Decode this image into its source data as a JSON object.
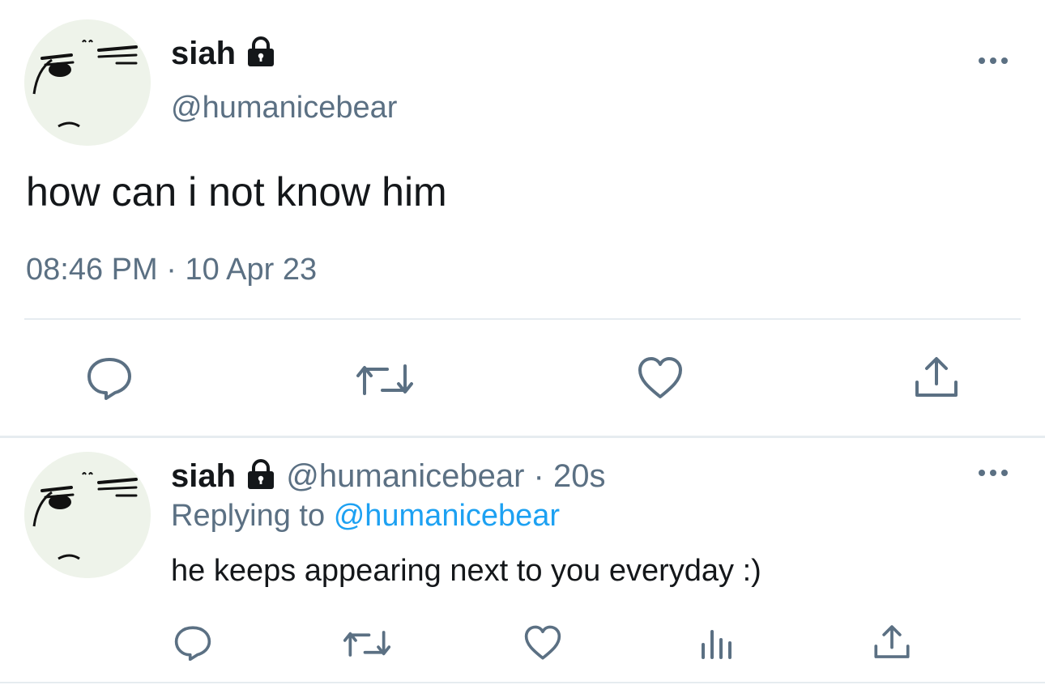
{
  "main_tweet": {
    "display_name": "siah",
    "handle": "@humanicebear",
    "text": "how can i not know him",
    "time": "08:46 PM",
    "separator": "·",
    "date": "10 Apr 23",
    "icons": [
      "reply-icon",
      "retweet-icon",
      "like-icon",
      "share-icon"
    ]
  },
  "reply": {
    "display_name": "siah",
    "handle": "@humanicebear",
    "separator": "·",
    "age": "20s",
    "replying_prefix": "Replying to",
    "replying_to": "@humanicebear",
    "text": "he keeps appearing next to you everyday :)",
    "icons": [
      "reply-icon",
      "retweet-icon",
      "like-icon",
      "analytics-icon",
      "share-icon"
    ]
  },
  "colors": {
    "text": "#14171a",
    "secondary": "#5b7083",
    "link": "#1da1f2",
    "divider": "#e6ecf0",
    "avatar_bg": "#eef3ea"
  }
}
